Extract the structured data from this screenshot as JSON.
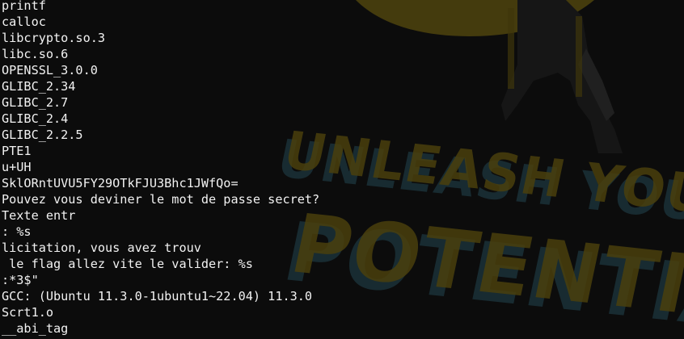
{
  "wallpaper": {
    "line1": "UNLEASH YOU",
    "line2": "POTENTIA",
    "colors": {
      "mascot": "#4a400d",
      "text_blue": "#1c363e",
      "background": "#0c0c0c"
    }
  },
  "terminal": {
    "text_color": "#f2f2f2",
    "lines": [
      "printf",
      "calloc",
      "libcrypto.so.3",
      "libc.so.6",
      "OPENSSL_3.0.0",
      "GLIBC_2.34",
      "GLIBC_2.7",
      "GLIBC_2.4",
      "GLIBC_2.2.5",
      "PTE1",
      "u+UH",
      "SklORntUVU5FY29OTkFJU3Bhc1JWfQo=",
      "Pouvez vous deviner le mot de passe secret?",
      "Texte entr",
      ": %s",
      "licitation, vous avez trouv",
      " le flag allez vite le valider: %s",
      ":*3$\"",
      "GCC: (Ubuntu 11.3.0-1ubuntu1~22.04) 11.3.0",
      "Scrt1.o",
      "__abi_tag"
    ]
  }
}
